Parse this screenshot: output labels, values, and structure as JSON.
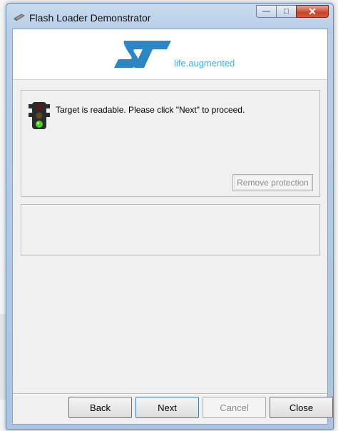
{
  "window": {
    "title": "Flash Loader Demonstrator",
    "caption_buttons": {
      "minimize": "—",
      "maximize": "□",
      "close": "✕"
    }
  },
  "banner": {
    "logo_text": "ST",
    "tagline": "life.augmented",
    "colors": {
      "logo": "#2c86c4",
      "tagline": "#3bb3e6"
    }
  },
  "status": {
    "indicator": "traffic-light-green",
    "message": "Target is readable. Please click \"Next\" to proceed.",
    "remove_protection_label": "Remove protection",
    "remove_protection_enabled": false
  },
  "footer": {
    "back_label": "Back",
    "next_label": "Next",
    "cancel_label": "Cancel",
    "cancel_enabled": false,
    "close_label": "Close"
  }
}
